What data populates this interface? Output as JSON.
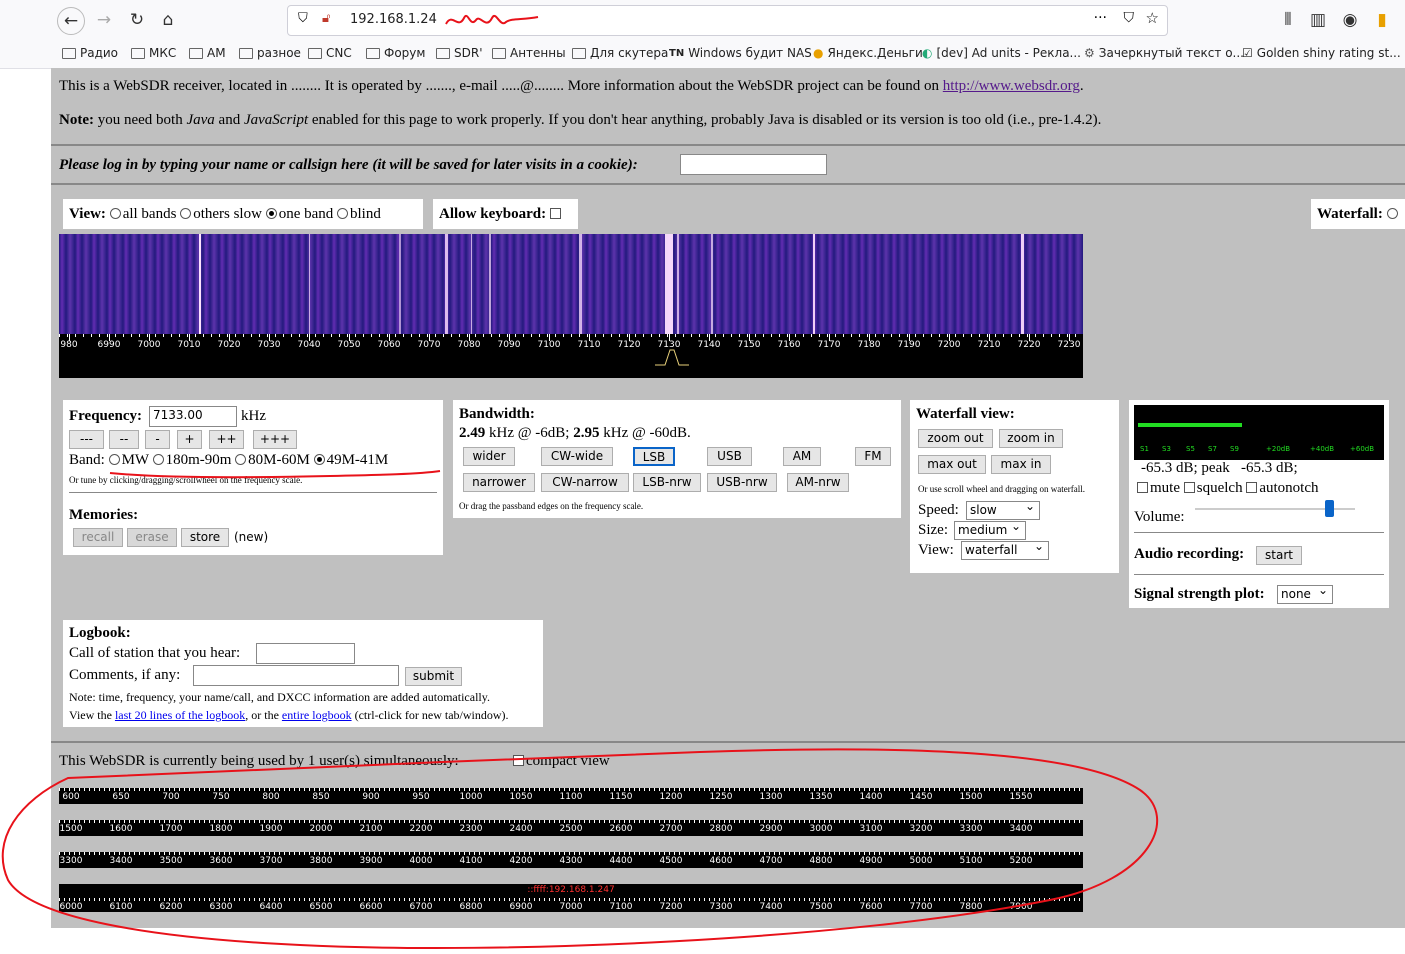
{
  "browser": {
    "url": "192.168.1.24",
    "bookmarks": [
      "Радио",
      "МКС",
      "AM",
      "разное",
      "CNC",
      "Форум",
      "SDR'",
      "Антенны",
      "Для скутера",
      "Windows будит NAS",
      "Яндекс.Деньги",
      "[dev] Ad units - Рекла...",
      "Зачеркнутый текст о...",
      "Golden shiny rating st..."
    ]
  },
  "intro": {
    "line1_pre": "This is a WebSDR receiver, located in ........ It is operated by ......., e-mail .....@........ More information about the WebSDR project can be found on ",
    "line1_link": "http://www.websdr.org",
    "line1_post": ".",
    "note_bold": "Note:",
    "note_a": " you need both ",
    "note_java": "Java",
    "note_b": " and ",
    "note_js": "JavaScript",
    "note_c": " enabled for this page to work properly. If you don't hear anything, probably Java is disabled or its version is too old (i.e., pre-1.4.2)."
  },
  "login": {
    "label": "Please log in by typing your name or callsign here (it will be saved for later visits in a cookie):",
    "value": ""
  },
  "view": {
    "label": "View:",
    "options": [
      "all bands",
      "others slow",
      "one band",
      "blind"
    ],
    "selected": "one band",
    "keyboard_label": "Allow keyboard:",
    "waterfall_label": "Waterfall:"
  },
  "scale": {
    "labels": [
      "980",
      "6990",
      "7000",
      "7010",
      "7020",
      "7030",
      "7040",
      "7050",
      "7060",
      "7070",
      "7080",
      "7090",
      "7100",
      "7110",
      "7120",
      "7130",
      "7140",
      "7150",
      "7160",
      "7170",
      "7180",
      "7190",
      "7200",
      "7210",
      "7220",
      "7230"
    ]
  },
  "frequency": {
    "label": "Frequency:",
    "value": "7133.00",
    "unit": "kHz",
    "step_buttons": [
      "---",
      "--",
      "-",
      "+",
      "++",
      "+++"
    ],
    "band_label": "Band:",
    "bands": [
      "MW",
      "180m-90m",
      "80M-60M",
      "49M-41M"
    ],
    "band_selected": "49M-41M",
    "tune_hint": "Or tune by clicking/dragging/scrollwheel on the frequency scale."
  },
  "memories": {
    "label": "Memories:",
    "buttons": [
      "recall",
      "erase",
      "store"
    ],
    "note": "(new)"
  },
  "bandwidth": {
    "label": "Bandwidth:",
    "v1": "2.49",
    "t1": " kHz @ -6dB; ",
    "v2": "2.95",
    "t2": " kHz @ -60dB.",
    "row1": [
      "wider",
      "CW-wide",
      "LSB",
      "USB",
      "AM",
      "FM"
    ],
    "row2": [
      "narrower",
      "CW-narrow",
      "LSB-nrw",
      "USB-nrw",
      "AM-nrw"
    ],
    "active": "LSB",
    "hint": "Or drag the passband edges on the frequency scale."
  },
  "waterfall_view": {
    "label": "Waterfall view:",
    "buttons": [
      "zoom out",
      "zoom in",
      "max out",
      "max in"
    ],
    "hint": "Or use scroll wheel and dragging on waterfall.",
    "speed_label": "Speed:",
    "speed": "slow",
    "size_label": "Size:",
    "size": "medium",
    "view_label": "View:",
    "view": "waterfall"
  },
  "smeter": {
    "scale": [
      "S1",
      "S3",
      "S5",
      "S7",
      "S9",
      "+20dB",
      "+40dB",
      "+60dB"
    ],
    "level": "-65.3 dB; peak",
    "peak": "-65.3 dB;",
    "checks": [
      "mute",
      "squelch",
      "autonotch"
    ],
    "volume_label": "Volume:",
    "volume_fraction": 0.84,
    "recording_label": "Audio recording:",
    "recording_button": "start",
    "plot_label": "Signal strength plot:",
    "plot_value": "none"
  },
  "logbook": {
    "label": "Logbook:",
    "call_label": "Call of station that you hear:",
    "comments_label": "Comments, if any:",
    "submit": "submit",
    "note": "Note: time, frequency, your name/call, and DXCC information are added automatically.",
    "view_pre": "View the ",
    "link1": "last 20 lines of the logbook",
    "view_mid": ", or the ",
    "link2": "entire logbook",
    "view_post": " (ctrl-click for new tab/window)."
  },
  "users": {
    "text": "This WebSDR is currently being used by 1 user(s) simultaneously:",
    "compact": "compact view",
    "ip": "::ffff:192.168.1.247"
  },
  "band_scales": [
    [
      "600",
      "650",
      "700",
      "750",
      "800",
      "850",
      "900",
      "950",
      "1000",
      "1050",
      "1100",
      "1150",
      "1200",
      "1250",
      "1300",
      "1350",
      "1400",
      "1450",
      "1500",
      "1550"
    ],
    [
      "1500",
      "1600",
      "1700",
      "1800",
      "1900",
      "2000",
      "2100",
      "2200",
      "2300",
      "2400",
      "2500",
      "2600",
      "2700",
      "2800",
      "2900",
      "3000",
      "3100",
      "3200",
      "3300",
      "3400"
    ],
    [
      "3300",
      "3400",
      "3500",
      "3600",
      "3700",
      "3800",
      "3900",
      "4000",
      "4100",
      "4200",
      "4300",
      "4400",
      "4500",
      "4600",
      "4700",
      "4800",
      "4900",
      "5000",
      "5100",
      "5200"
    ],
    [
      "6000",
      "6100",
      "6200",
      "6300",
      "6400",
      "6500",
      "6600",
      "6700",
      "6800",
      "6900",
      "7000",
      "7100",
      "7200",
      "7300",
      "7400",
      "7500",
      "7600",
      "7700",
      "7800",
      "7900"
    ]
  ],
  "colors": {
    "annotation": "#e8121a",
    "page_bg": "#c0c0c0",
    "scale_bg": "#000000",
    "smeter_bar": "#22dd22"
  }
}
